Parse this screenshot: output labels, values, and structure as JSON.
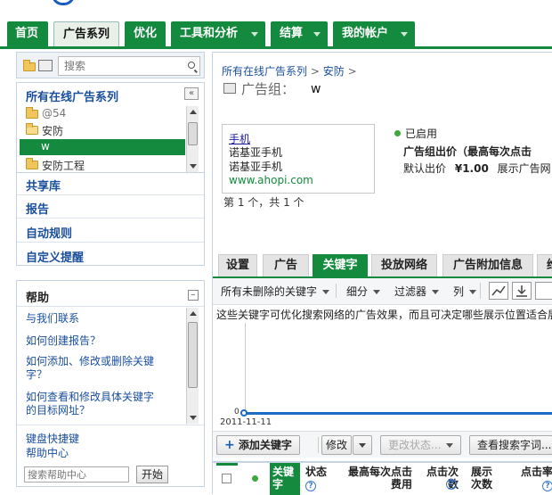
{
  "nav": {
    "tabs": [
      "首页",
      "广告系列",
      "优化",
      "工具和分析",
      "结算",
      "我的帐户"
    ],
    "active": "广告系列"
  },
  "sidebar": {
    "search_placeholder": "搜索",
    "campaigns_title": "所有在线广告系列",
    "collapse_glyph": "«",
    "tree": [
      {
        "label": "@54",
        "level": 0,
        "muted": true
      },
      {
        "label": "安防",
        "level": 0
      },
      {
        "label": "w",
        "level": 1,
        "selected": true
      },
      {
        "label": "安防工程",
        "level": 0
      }
    ],
    "sections": [
      "共享库",
      "报告",
      "自动规则",
      "自定义提醒"
    ],
    "help": {
      "title": "帮助",
      "collapse_glyph": "–",
      "links": [
        "与我们联系",
        "如何创建报告？",
        "如何添加、修改或删除关键字？",
        "如何查看和修改具体关键字的目标网址？"
      ],
      "shortcuts": "键盘快捷键",
      "help_center": "帮助中心",
      "search_placeholder": "搜索帮助中心",
      "search_button": "开始"
    }
  },
  "main": {
    "breadcrumb": [
      "所有在线广告系列",
      "安防"
    ],
    "breadcrumb_sep": ">",
    "adgroup_label": "广告组：",
    "adgroup_name": "w",
    "ad": {
      "headline": "手机",
      "line1": "诺基亚手机",
      "line2": "诺基亚手机",
      "url": "www.ahopi.com"
    },
    "pager": "第 1 个，共 1 个",
    "status": "已启用",
    "bid_label": "广告组出价（最高每次点击",
    "default_bid_label": "默认出价",
    "default_bid_value": "¥1.00",
    "display_label": "展示广告网",
    "tabs": [
      "设置",
      "广告",
      "关键字",
      "投放网络",
      "广告附加信息",
      "维"
    ],
    "active_tab": "关键字",
    "toolbar": {
      "filter_all": "所有未删除的关键字",
      "segment": "细分",
      "filter": "过滤器",
      "columns": "列"
    },
    "info_text": "这些关键字可优化搜索网络的广告效果，而且可决定哪些展示位置适合展",
    "chart": {
      "date_label": "2011-11-11",
      "zero_label": "0"
    },
    "actions": {
      "add_keyword": "添加关键字",
      "edit": "修改",
      "change_status": "更改状态...",
      "search_terms": "查看搜索字词..."
    },
    "table_headers": {
      "keyword": "关键字",
      "status": "状态",
      "max_cpc": "最高每次点击费用",
      "clicks": "点击次数",
      "impressions": "展示次数",
      "ctr": "点击率"
    }
  },
  "colors": {
    "brand_green": "#138a3e",
    "link_blue": "#1a4f9c"
  }
}
